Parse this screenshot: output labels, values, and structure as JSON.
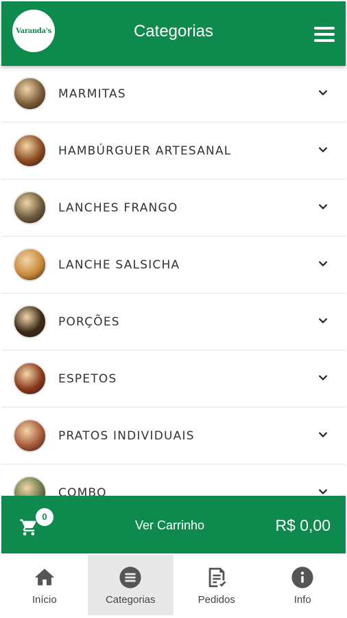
{
  "header": {
    "title": "Categorias",
    "logo_text": "Varanda's",
    "logo_icon": "restaurant-logo",
    "menu_icon": "hamburger-menu-icon"
  },
  "categories": [
    {
      "label": "MARMITAS",
      "thumb_color": "#7a5c3a"
    },
    {
      "label": "HAMBÚRGUER ARTESANAL",
      "thumb_color": "#8b4a1f"
    },
    {
      "label": "LANCHES FRANGO",
      "thumb_color": "#6b5a3a"
    },
    {
      "label": "LANCHE SALSICHA",
      "thumb_color": "#c98a3a"
    },
    {
      "label": "PORÇÕES",
      "thumb_color": "#3b2a1a"
    },
    {
      "label": "ESPETOS",
      "thumb_color": "#8a3a1f"
    },
    {
      "label": "PRATOS INDIVIDUAIS",
      "thumb_color": "#a85a3a"
    },
    {
      "label": "COMBO",
      "thumb_color": "#6a7a4a"
    }
  ],
  "cart": {
    "badge": "0",
    "label": "Ver Carrinho",
    "total": "R$ 0,00"
  },
  "tabs": [
    {
      "label": "Início",
      "icon": "home-icon",
      "active": false
    },
    {
      "label": "Categorias",
      "icon": "list-icon",
      "active": true
    },
    {
      "label": "Pedidos",
      "icon": "orders-icon",
      "active": false
    },
    {
      "label": "Info",
      "icon": "info-icon",
      "active": false
    }
  ],
  "colors": {
    "primary": "#0f8a4f",
    "icon_gray": "#555555"
  }
}
